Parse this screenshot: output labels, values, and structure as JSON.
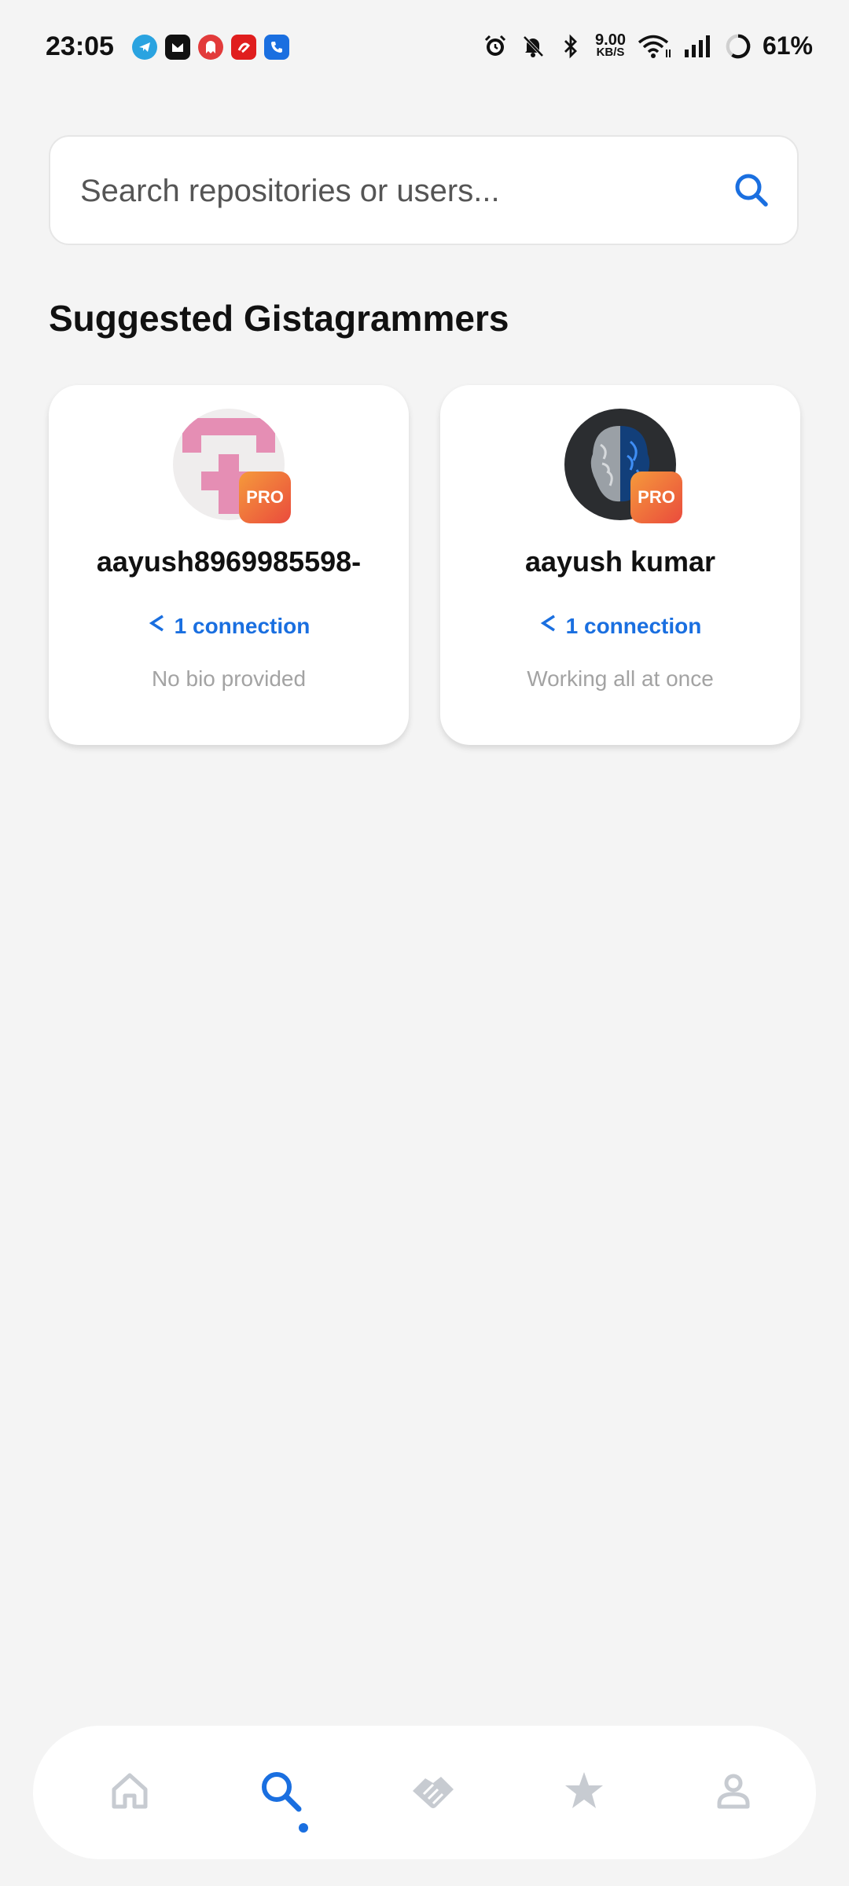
{
  "status_bar": {
    "time": "23:05",
    "speed_value": "9.00",
    "speed_unit": "KB/S",
    "battery": "61%",
    "icons": [
      "telegram-icon",
      "messenger-icon",
      "ghost-app-icon",
      "airtel-icon",
      "phone-app-icon",
      "alarm-icon",
      "mute-icon",
      "bluetooth-icon",
      "wifi-icon",
      "signal-icon",
      "battery-icon"
    ]
  },
  "search": {
    "placeholder": "Search repositories or users..."
  },
  "section": {
    "title": "Suggested Gistagrammers"
  },
  "users": [
    {
      "name": "aayush8969985598-",
      "badge": "PRO",
      "connections": "1 connection",
      "bio": "No bio provided"
    },
    {
      "name": "aayush kumar",
      "badge": "PRO",
      "connections": "1 connection",
      "bio": "Working all at once"
    }
  ],
  "bottom_nav": {
    "items": [
      "home-icon",
      "search-icon",
      "handshake-icon",
      "star-icon",
      "profile-icon"
    ],
    "active": "search-icon"
  },
  "colors": {
    "accent": "#1a6fe0",
    "background": "#f4f4f4",
    "pro_badge_start": "#f59a3b",
    "pro_badge_end": "#ea4b3d",
    "nav_inactive": "#c7cbd1"
  }
}
